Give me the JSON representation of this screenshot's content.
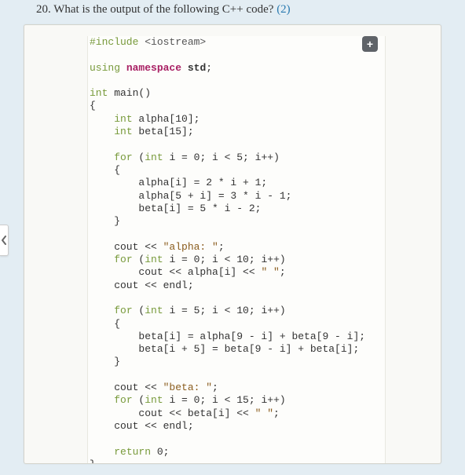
{
  "question": {
    "number": "20.",
    "text": "What is the output of the following C++ code?",
    "points": "(2)"
  },
  "expand_label": "+",
  "code": {
    "l1_a": "#include",
    "l1_b": " <iostream>",
    "l3_a": "using",
    "l3_b": " namespace ",
    "l3_c": "std",
    "l3_d": ";",
    "l5_a": "int",
    "l5_b": " main()",
    "l6": "{",
    "l7_a": "    ",
    "l7_b": "int",
    "l7_c": " alpha[10];",
    "l8_a": "    ",
    "l8_b": "int",
    "l8_c": " beta[15];",
    "l10_a": "    ",
    "l10_b": "for",
    "l10_c": " (",
    "l10_d": "int",
    "l10_e": " i = 0; i < 5; i++)",
    "l11": "    {",
    "l12": "        alpha[i] = 2 * i + 1;",
    "l13": "        alpha[5 + i] = 3 * i - 1;",
    "l14": "        beta[i] = 5 * i - 2;",
    "l15": "    }",
    "l17_a": "    cout << ",
    "l17_b": "\"alpha: \"",
    "l17_c": ";",
    "l18_a": "    ",
    "l18_b": "for",
    "l18_c": " (",
    "l18_d": "int",
    "l18_e": " i = 0; i < 10; i++)",
    "l19_a": "        cout << alpha[i] << ",
    "l19_b": "\" \"",
    "l19_c": ";",
    "l20": "    cout << endl;",
    "l22_a": "    ",
    "l22_b": "for",
    "l22_c": " (",
    "l22_d": "int",
    "l22_e": " i = 5; i < 10; i++)",
    "l23": "    {",
    "l24": "        beta[i] = alpha[9 - i] + beta[9 - i];",
    "l25": "        beta[i + 5] = beta[9 - i] + beta[i];",
    "l26": "    }",
    "l28_a": "    cout << ",
    "l28_b": "\"beta: \"",
    "l28_c": ";",
    "l29_a": "    ",
    "l29_b": "for",
    "l29_c": " (",
    "l29_d": "int",
    "l29_e": " i = 0; i < 15; i++)",
    "l30_a": "        cout << beta[i] << ",
    "l30_b": "\" \"",
    "l30_c": ";",
    "l31": "    cout << endl;",
    "l33_a": "    ",
    "l33_b": "return",
    "l33_c": " 0;",
    "l34": "}"
  }
}
